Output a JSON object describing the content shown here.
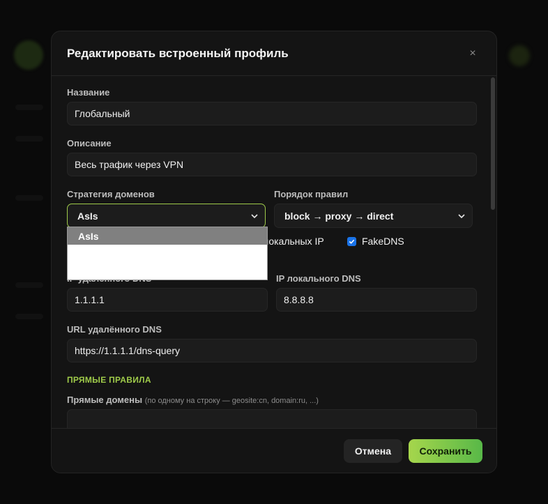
{
  "dialog": {
    "title": "Редактировать встроенный профиль",
    "close_icon": "×"
  },
  "form": {
    "name_label": "Название",
    "name_value": "Глобальный",
    "description_label": "Описание",
    "description_value": "Весь трафик через VPN",
    "domain_strategy_label": "Стратегия доменов",
    "domain_strategy_value": "AsIs",
    "rule_order_label": "Порядок правил",
    "rule_order_value": "block → proxy → direct",
    "local_ip_check_label": "локальных IP",
    "fakedns_label": "FakeDNS",
    "fakedns_checked": true,
    "remote_dns_ip_label": "IP удалённого DNS",
    "remote_dns_ip_value": "1.1.1.1",
    "local_dns_ip_label": "IP локального DNS",
    "local_dns_ip_value": "8.8.8.8",
    "remote_dns_url_label": "URL удалённого DNS",
    "remote_dns_url_value": "https://1.1.1.1/dns-query",
    "direct_rules_section": "ПРЯМЫЕ ПРАВИЛА",
    "direct_domains_label": "Прямые домены",
    "direct_domains_hint": "(по одному на строку — geosite:cn, domain:ru, ...)"
  },
  "dropdown": {
    "options": [
      "AsIs"
    ]
  },
  "footer": {
    "cancel_label": "Отмена",
    "save_label": "Сохранить"
  },
  "colors": {
    "accent": "#9fcb4a",
    "checkbox": "#1a73e8"
  }
}
